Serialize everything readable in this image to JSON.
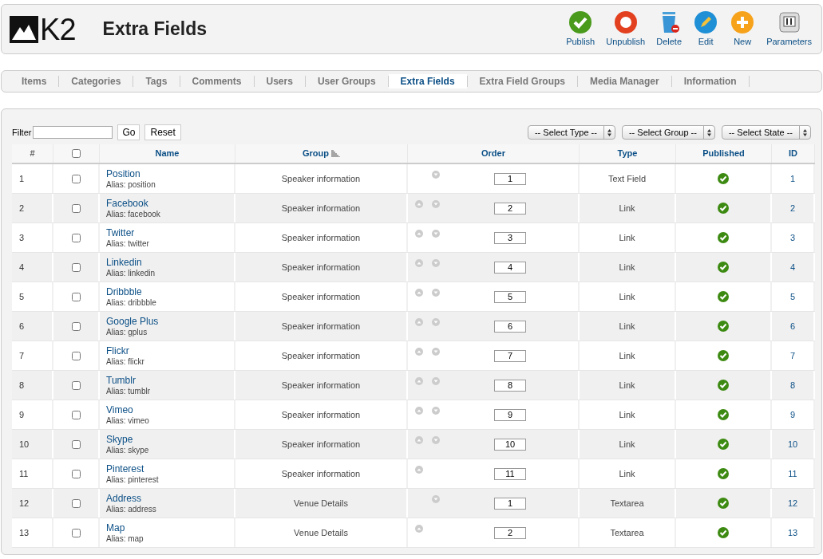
{
  "header": {
    "logo": "K2",
    "title": "Extra Fields",
    "toolbar": [
      {
        "kind": "publish",
        "label": "Publish"
      },
      {
        "kind": "unpublish",
        "label": "Unpublish"
      },
      {
        "kind": "delete",
        "label": "Delete"
      },
      {
        "kind": "edit",
        "label": "Edit"
      },
      {
        "kind": "new",
        "label": "New"
      },
      {
        "kind": "parameters",
        "label": "Parameters"
      }
    ]
  },
  "tabs": [
    {
      "label": "Items",
      "selected": false
    },
    {
      "label": "Categories",
      "selected": false
    },
    {
      "label": "Tags",
      "selected": false
    },
    {
      "label": "Comments",
      "selected": false
    },
    {
      "label": "Users",
      "selected": false
    },
    {
      "label": "User Groups",
      "selected": false
    },
    {
      "label": "Extra Fields",
      "selected": true
    },
    {
      "label": "Extra Field Groups",
      "selected": false
    },
    {
      "label": "Media Manager",
      "selected": false
    },
    {
      "label": "Information",
      "selected": false
    }
  ],
  "filter": {
    "label": "Filter",
    "go": "Go",
    "reset": "Reset",
    "selects": [
      "-- Select Type --",
      "-- Select Group --",
      "-- Select State --"
    ]
  },
  "table": {
    "columns": [
      "#",
      "",
      "Name",
      "Group",
      "Order",
      "Type",
      "Published",
      "ID"
    ],
    "select_all_checked": false,
    "rows": [
      {
        "num": "1",
        "checked": false,
        "name": "Position",
        "alias": "Alias: position",
        "group": "Speaker information",
        "up": false,
        "down": true,
        "order": "1",
        "type": "Text Field",
        "published": true,
        "id": "1"
      },
      {
        "num": "2",
        "checked": false,
        "name": "Facebook",
        "alias": "Alias: facebook",
        "group": "Speaker information",
        "up": true,
        "down": true,
        "order": "2",
        "type": "Link",
        "published": true,
        "id": "2"
      },
      {
        "num": "3",
        "checked": false,
        "name": "Twitter",
        "alias": "Alias: twitter",
        "group": "Speaker information",
        "up": true,
        "down": true,
        "order": "3",
        "type": "Link",
        "published": true,
        "id": "3"
      },
      {
        "num": "4",
        "checked": false,
        "name": "Linkedin",
        "alias": "Alias: linkedin",
        "group": "Speaker information",
        "up": true,
        "down": true,
        "order": "4",
        "type": "Link",
        "published": true,
        "id": "4"
      },
      {
        "num": "5",
        "checked": false,
        "name": "Dribbble",
        "alias": "Alias: dribbble",
        "group": "Speaker information",
        "up": true,
        "down": true,
        "order": "5",
        "type": "Link",
        "published": true,
        "id": "5"
      },
      {
        "num": "6",
        "checked": false,
        "name": "Google Plus",
        "alias": "Alias: gplus",
        "group": "Speaker information",
        "up": true,
        "down": true,
        "order": "6",
        "type": "Link",
        "published": true,
        "id": "6"
      },
      {
        "num": "7",
        "checked": false,
        "name": "Flickr",
        "alias": "Alias: flickr",
        "group": "Speaker information",
        "up": true,
        "down": true,
        "order": "7",
        "type": "Link",
        "published": true,
        "id": "7"
      },
      {
        "num": "8",
        "checked": false,
        "name": "Tumblr",
        "alias": "Alias: tumblr",
        "group": "Speaker information",
        "up": true,
        "down": true,
        "order": "8",
        "type": "Link",
        "published": true,
        "id": "8"
      },
      {
        "num": "9",
        "checked": false,
        "name": "Vimeo",
        "alias": "Alias: vimeo",
        "group": "Speaker information",
        "up": true,
        "down": true,
        "order": "9",
        "type": "Link",
        "published": true,
        "id": "9"
      },
      {
        "num": "10",
        "checked": false,
        "name": "Skype",
        "alias": "Alias: skype",
        "group": "Speaker information",
        "up": true,
        "down": true,
        "order": "10",
        "type": "Link",
        "published": true,
        "id": "10"
      },
      {
        "num": "11",
        "checked": false,
        "name": "Pinterest",
        "alias": "Alias: pinterest",
        "group": "Speaker information",
        "up": true,
        "down": false,
        "order": "11",
        "type": "Link",
        "published": true,
        "id": "11"
      },
      {
        "num": "12",
        "checked": false,
        "name": "Address",
        "alias": "Alias: address",
        "group": "Venue Details",
        "up": false,
        "down": true,
        "order": "1",
        "type": "Textarea",
        "published": true,
        "id": "12"
      },
      {
        "num": "13",
        "checked": false,
        "name": "Map",
        "alias": "Alias: map",
        "group": "Venue Details",
        "up": true,
        "down": false,
        "order": "2",
        "type": "Textarea",
        "published": true,
        "id": "13"
      }
    ]
  }
}
